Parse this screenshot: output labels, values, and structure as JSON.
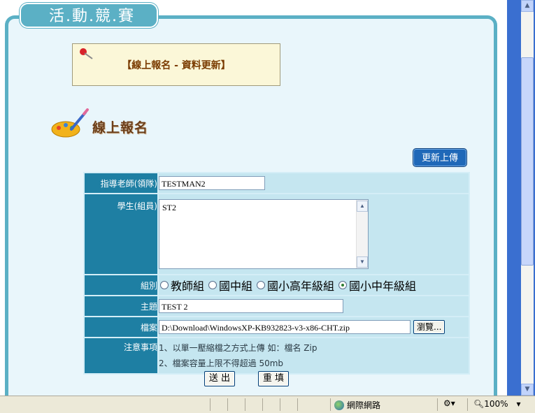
{
  "header": {
    "title": "活.動.競.賽"
  },
  "notice": {
    "text": "【線上報名 - 資料更新】"
  },
  "section": {
    "title": "線上報名"
  },
  "toolbar": {
    "update_label": "更新上傳"
  },
  "form": {
    "teacher": {
      "label": "指導老師(領隊)",
      "value": "TESTMAN2"
    },
    "students": {
      "label": "學生(組員)",
      "value": "ST2"
    },
    "group": {
      "label": "組別",
      "options": [
        "教師組",
        "國中組",
        "國小高年級組",
        "國小中年級組"
      ],
      "selected": "國小中年級組"
    },
    "topic": {
      "label": "主題",
      "value": "TEST 2"
    },
    "file": {
      "label": "檔案",
      "value": "D:\\Download\\WindowsXP-KB932823-v3-x86-CHT.zip",
      "browse_label": "瀏覽..."
    },
    "notes": {
      "label": "注意事項",
      "lines": [
        "1、以單一壓縮檔之方式上傳 如：檔名 Zip",
        "2、檔案容量上限不得超過 50mb"
      ]
    }
  },
  "actions": {
    "submit_label": "送 出",
    "reset_label": "重 填"
  },
  "statusbar": {
    "zone_label": "網際網路",
    "zoom_label": "100%"
  }
}
